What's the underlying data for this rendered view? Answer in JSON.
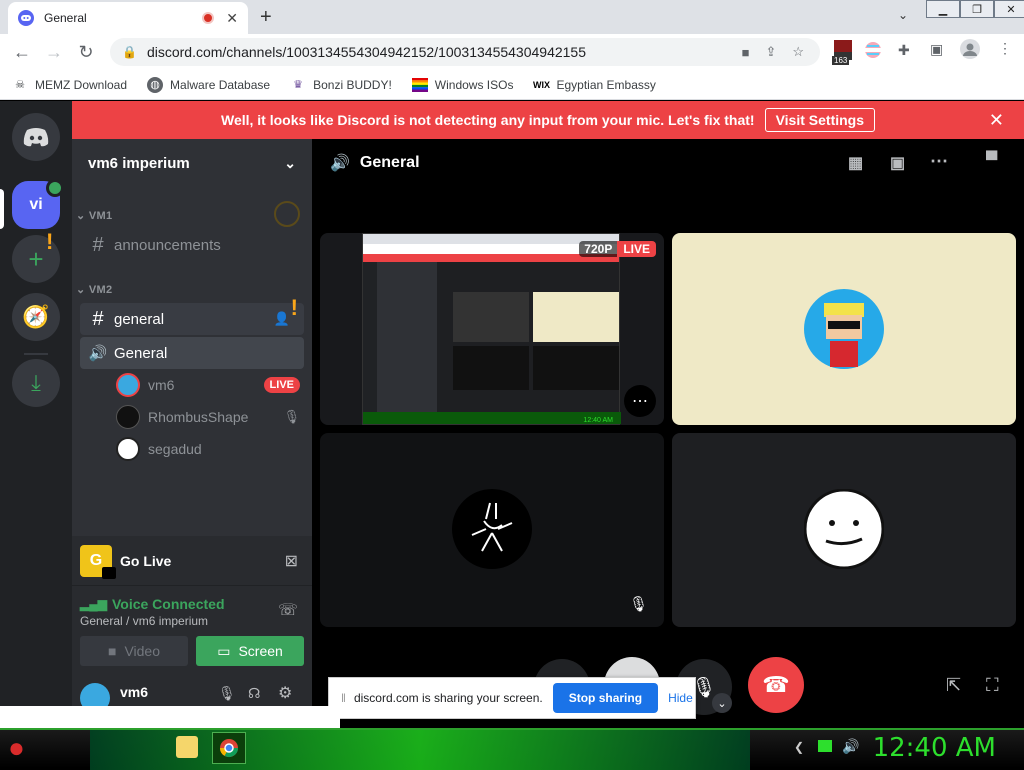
{
  "browser": {
    "tab_title": "General",
    "url": "discord.com/channels/1003134554304942152/1003134554304942155",
    "extension_badge": "163",
    "bookmarks": [
      {
        "label": "MEMZ Download",
        "icon": "skull-icon"
      },
      {
        "label": "Malware Database",
        "icon": "globe-icon"
      },
      {
        "label": "Bonzi BUDDY!",
        "icon": "bonzi-icon"
      },
      {
        "label": "Windows ISOs",
        "icon": "rainbow-flag-icon"
      },
      {
        "label": "Egyptian Embassy",
        "icon": "wix-icon"
      }
    ]
  },
  "banner": {
    "message": "Well, it looks like Discord is not detecting any input from your mic. Let's fix that!",
    "button": "Visit Settings"
  },
  "guilds": {
    "server_initials": "vi"
  },
  "sidebar": {
    "server_name": "vm6 imperium",
    "categories": [
      {
        "name": "VM1",
        "channels": [
          {
            "name": "announcements",
            "type": "text"
          }
        ]
      },
      {
        "name": "VM2",
        "channels": [
          {
            "name": "general",
            "type": "text"
          },
          {
            "name": "General",
            "type": "voice"
          }
        ]
      }
    ],
    "voice_users": [
      {
        "name": "vm6",
        "badge": "LIVE"
      },
      {
        "name": "RhombusShape",
        "badge": ""
      },
      {
        "name": "segadud",
        "badge": ""
      }
    ],
    "go_live": {
      "label": "Go Live",
      "icon_letter": "G"
    },
    "voice_connected": {
      "status": "Voice Connected",
      "location": "General / vm6 imperium"
    },
    "buttons": {
      "video": "Video",
      "screen": "Screen"
    },
    "user": {
      "name": "vm6"
    }
  },
  "main": {
    "channel_title": "General",
    "stream_badge_quality": "720P",
    "stream_badge_live": "LIVE",
    "stream_clock": "12:40 AM"
  },
  "share_bar": {
    "message": "discord.com is sharing your screen.",
    "stop": "Stop sharing",
    "hide": "Hide"
  },
  "taskbar": {
    "clock": "12:40 AM"
  },
  "colors": {
    "blurple": "#5865f2",
    "danger": "#ed4245",
    "voice_green": "#3ba55d",
    "taskbar_green": "#2ddf2d"
  }
}
